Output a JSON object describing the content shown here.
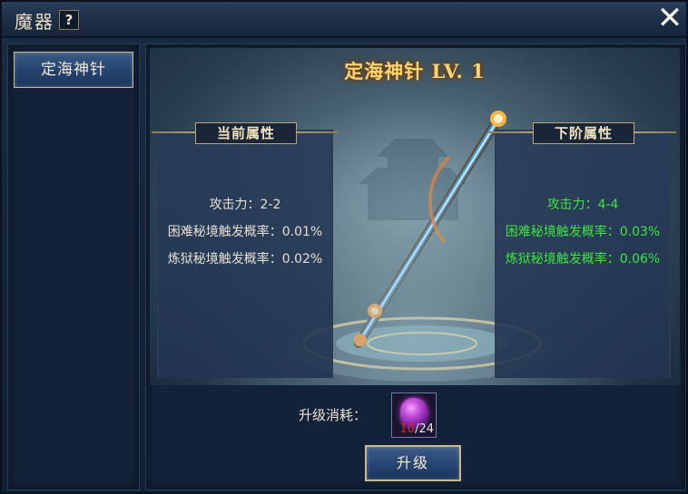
{
  "window": {
    "title": "魔器",
    "help_label": "?",
    "close_label": "✕"
  },
  "sidebar": {
    "items": [
      {
        "label": "定海神针",
        "selected": true
      }
    ]
  },
  "artifact": {
    "title": "定海神针 LV.  1",
    "name": "定海神针",
    "level": 1
  },
  "current": {
    "header": "当前属性",
    "attrs": [
      "攻击力：2-2",
      "困难秘境触发概率：0.01%",
      "炼狱秘境触发概率：0.02%"
    ]
  },
  "next": {
    "header": "下阶属性",
    "attrs": [
      "攻击力：4-4",
      "困难秘境触发概率：0.03%",
      "炼狱秘境触发概率：0.06%"
    ]
  },
  "cost": {
    "label": "升级消耗：",
    "item_icon": "purple-gem-icon",
    "have": "10",
    "sep": "/",
    "need": "24"
  },
  "upgrade_button": {
    "label": "升级"
  },
  "colors": {
    "title_gold": "#f6d574",
    "next_attr_green": "#3fe33f",
    "insufficient_red": "#e02a2a",
    "frame_gold": "#c8b88c"
  }
}
